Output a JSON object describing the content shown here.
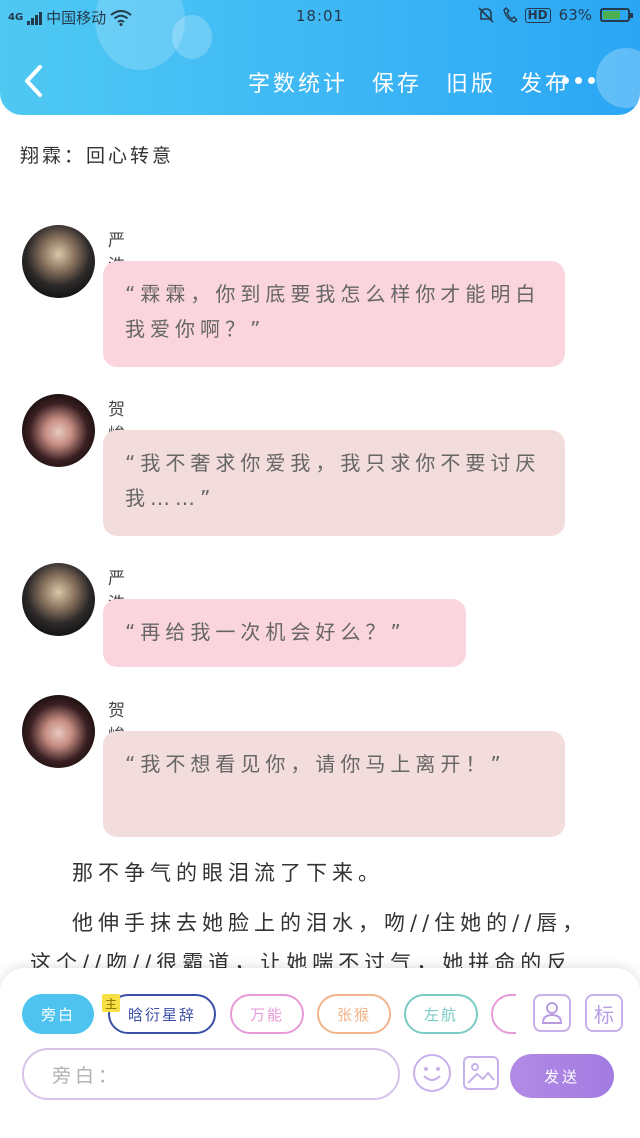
{
  "status_bar": {
    "network": "4G",
    "carrier": "中国移动",
    "time": "18:01",
    "hd": "HD",
    "battery": "63%",
    "battery_level": 0.63
  },
  "toolbar": {
    "back_icon": "chevron-left-icon",
    "items": [
      "字数统计",
      "保存",
      "旧版",
      "发布"
    ],
    "more_icon": "more-dots-icon"
  },
  "chapter_title": "翔霖：回心转意",
  "messages": [
    {
      "speaker": "严浩翔",
      "text": "“霖霖，你到底要我怎么样你才能明白我爱你啊？”",
      "avatar": "严浩翔-avatar",
      "color": "#fbd5de"
    },
    {
      "speaker": "贺峻霖",
      "text": "“我不奢求你爱我，我只求你不要讨厌我……”",
      "avatar": "贺峻霖-avatar",
      "color": "#f3dcdc"
    },
    {
      "speaker": "严浩翔",
      "text": "“再给我一次机会好么？”",
      "avatar": "严浩翔-avatar",
      "color": "#fbd5de"
    },
    {
      "speaker": "贺峻霖",
      "text": "“我不想看见你，请你马上离开！”",
      "avatar": "贺峻霖-avatar",
      "color": "#f3dcdc"
    }
  ],
  "narration": [
    "那不争气的眼泪流了下来。",
    "他伸手抹去她脸上的泪水，吻//住她的//唇，这个//吻//很霸道，让她喘不过气，她拼命的反"
  ],
  "characters": {
    "chips": [
      {
        "label": "旁白",
        "active": true,
        "color": "#4ec3ef"
      },
      {
        "label": "晗衍星辞",
        "active": false,
        "color": "#3a4fa6",
        "badge": "主"
      },
      {
        "label": "万能",
        "active": false,
        "color": "#e79ad8"
      },
      {
        "label": "张猴",
        "active": false,
        "color": "#f2b48a"
      },
      {
        "label": "左航",
        "active": false,
        "color": "#79cbc4"
      },
      {
        "label": "",
        "active": false,
        "color": "#e79ad8"
      }
    ],
    "person_icon": "person-icon",
    "tag_button": "标"
  },
  "composer": {
    "placeholder": "旁白：",
    "emoji_icon": "smiley-icon",
    "image_icon": "image-icon",
    "send": "发送"
  }
}
